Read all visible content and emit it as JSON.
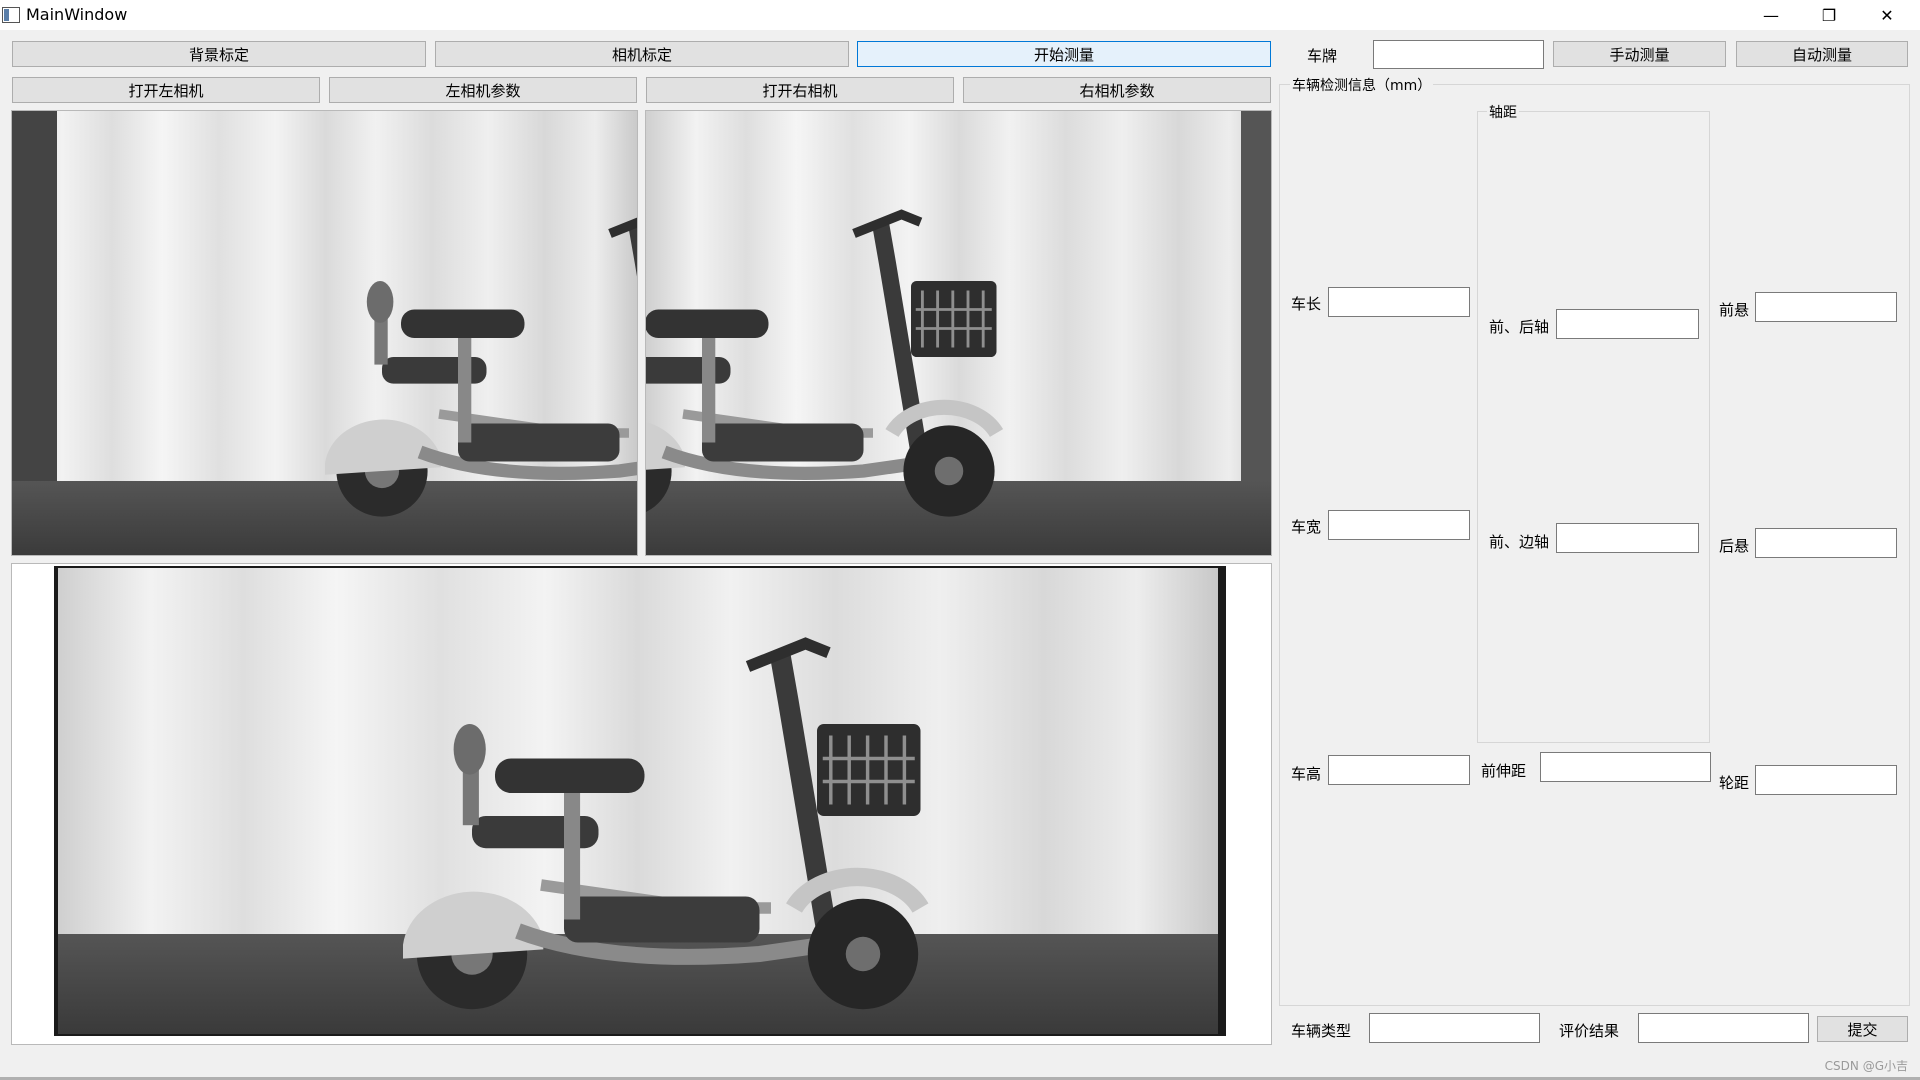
{
  "window": {
    "title": "MainWindow",
    "minimize": "—",
    "restore": "❐",
    "close": "✕"
  },
  "toolbar": {
    "background_calib": "背景标定",
    "camera_calib": "相机标定",
    "start_measure": "开始测量",
    "open_left_camera": "打开左相机",
    "left_camera_params": "左相机参数",
    "open_right_camera": "打开右相机",
    "right_camera_params": "右相机参数"
  },
  "plate": {
    "label": "车牌",
    "value": "",
    "manual_measure": "手动测量",
    "auto_measure": "自动测量"
  },
  "detection": {
    "group_title": "车辆检测信息（mm）",
    "wheelbase_group_title": "轴距",
    "length_label": "车长",
    "length_value": "",
    "width_label": "车宽",
    "width_value": "",
    "height_label": "车高",
    "height_value": "",
    "front_rear_axle_label": "前、后轴",
    "front_rear_axle_value": "",
    "front_side_axle_label": "前、边轴",
    "front_side_axle_value": "",
    "front_extension_label": "前伸距",
    "front_extension_value": "",
    "front_overhang_label": "前悬",
    "front_overhang_value": "",
    "rear_overhang_label": "后悬",
    "rear_overhang_value": "",
    "track_label": "轮距",
    "track_value": ""
  },
  "footer": {
    "vehicle_type_label": "车辆类型",
    "vehicle_type_value": "",
    "evaluation_label": "评价结果",
    "evaluation_value": "",
    "submit": "提交"
  },
  "watermark": "CSDN @G小吉",
  "colors": {
    "window_bg": "#f0f0f0",
    "button_bg": "#e1e1e1",
    "primary_border": "#0078d7",
    "primary_bg": "#e5f1fb"
  }
}
